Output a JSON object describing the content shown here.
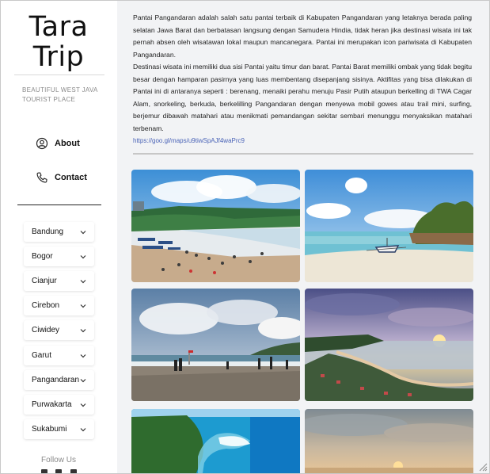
{
  "brand": {
    "line1": "Tara",
    "line2": "Trip",
    "tagline": "BEAUTIFUL WEST JAVA TOURIST PLACE"
  },
  "nav": [
    {
      "label": "About",
      "icon": "user-circle-icon"
    },
    {
      "label": "Contact",
      "icon": "phone-icon"
    }
  ],
  "regions": [
    "Bandung",
    "Bogor",
    "Cianjur",
    "Cirebon",
    "Ciwidey",
    "Garut",
    "Pangandaran",
    "Purwakarta",
    "Sukabumi"
  ],
  "follow": "Follow Us",
  "content": {
    "para1": "Pantai Pangandaran adalah salah satu pantai terbaik di Kabupaten Pangandaran yang letaknya berada paling selatan Jawa Barat dan berbatasan langsung dengan Samudera Hindia, tidak heran jika destinasi wisata ini tak pernah absen oleh wisatawan lokal maupun mancanegara. Pantai ini merupakan icon pariwisata di Kabupaten Pangandaran.",
    "para2": "Destinasi wisata ini memiliki dua sisi Pantai yaitu timur dan barat. Pantai Barat memiliki ombak yang tidak begitu besar dengan hamparan pasirnya yang luas membentang disepanjang sisinya. Aktifitas yang bisa dilakukan di Pantai ini di antaranya seperti : berenang, menaiki perahu menuju Pasir Putih ataupun berkelling di TWA Cagar Alam, snorkeling, berkuda, berkelilling Pangandaran dengan menyewa mobil gowes atau trail mini, surfing, berjemur dibawah matahari atau menikmati pemandangan sekitar sembari menunggu menyaksikan matahari terbenam.",
    "map_link": "https://goo.gl/maps/u9tiwSpAJf4waPrc9"
  },
  "colors": {
    "sidebar_bg": "#ffffff",
    "main_bg": "#f2f3f5",
    "link": "#4a63b7"
  }
}
